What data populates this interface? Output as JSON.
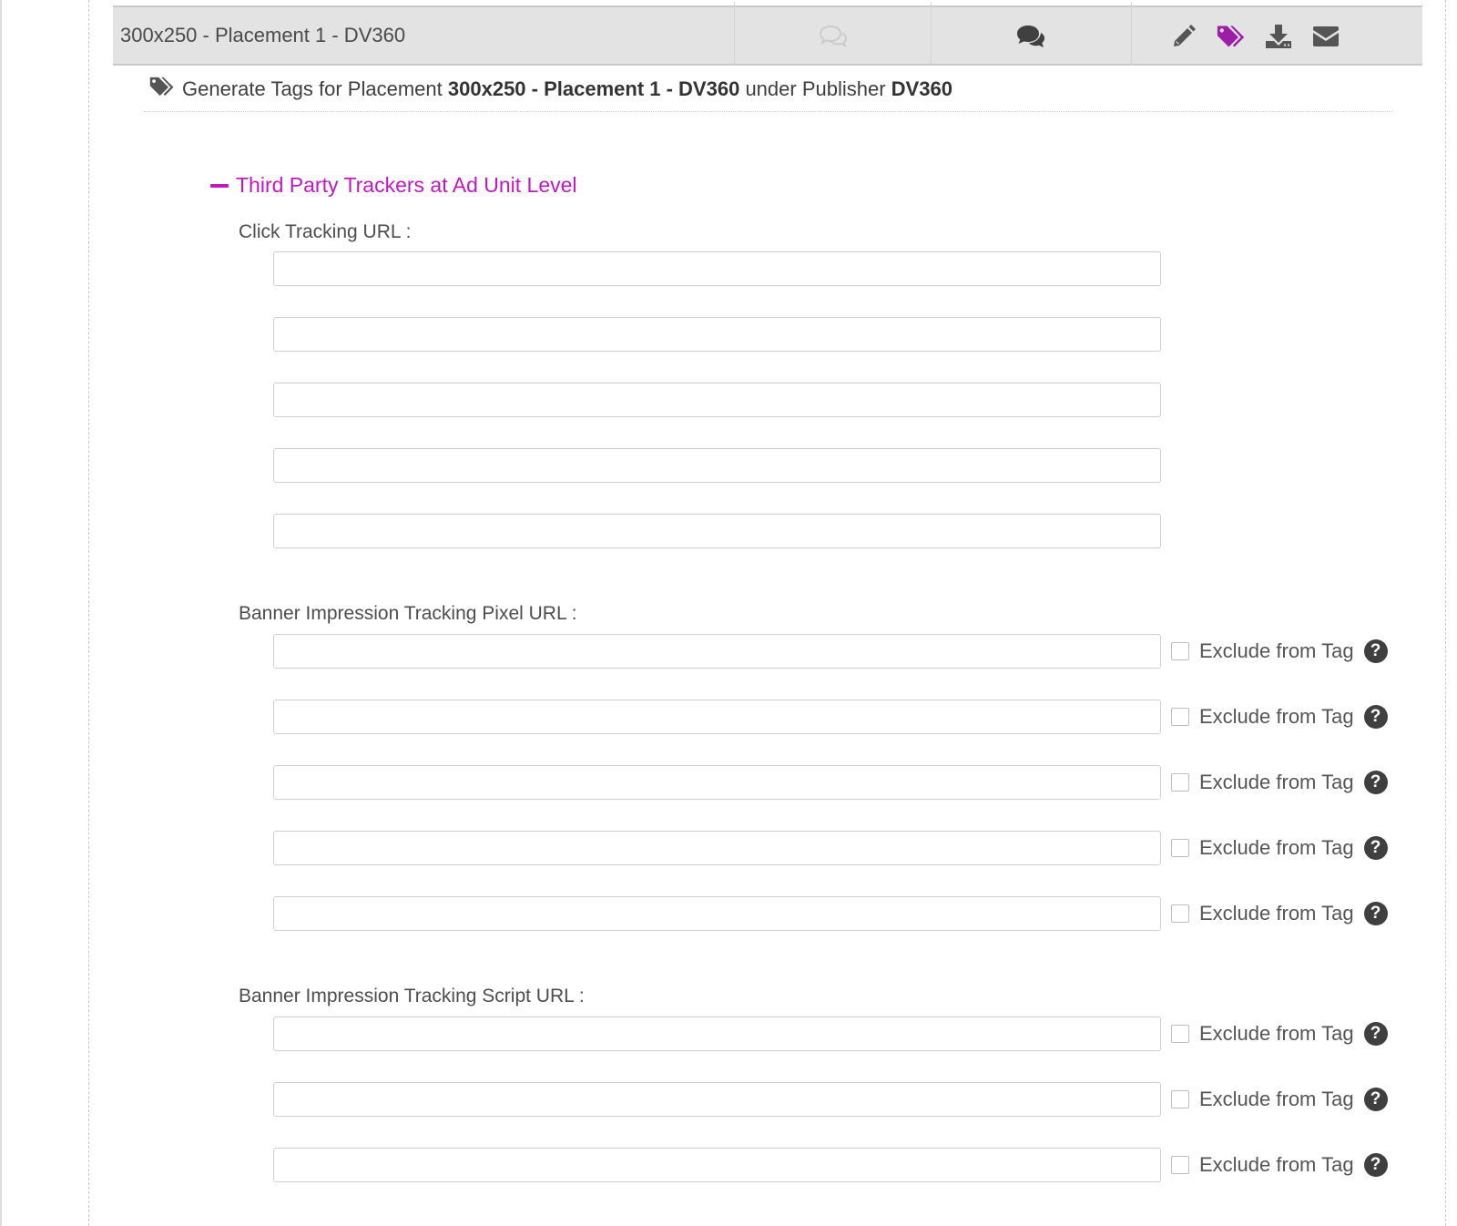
{
  "placement": {
    "name": "300x250 - Placement 1 - DV360",
    "icons": {
      "comments_outline": "comments-outline-icon",
      "comments": "comments-icon",
      "edit": "pencil-icon",
      "tags": "tags-icon",
      "download": "download-icon",
      "email": "envelope-icon"
    },
    "active_color": "#9b1fa6",
    "icon_color": "#555555"
  },
  "generate": {
    "prefix": "Generate Tags for Placement",
    "placement_name": "300x250 - Placement 1 - DV360",
    "middle": "under Publisher",
    "publisher": "DV360"
  },
  "section": {
    "title": "Third Party Trackers at Ad Unit Level",
    "accent_color": "#c018c4"
  },
  "click_tracking": {
    "label": "Click Tracking URL :",
    "values": [
      "",
      "",
      "",
      "",
      ""
    ]
  },
  "pixel_tracking": {
    "label": "Banner Impression Tracking Pixel URL :",
    "values": [
      "",
      "",
      "",
      "",
      ""
    ],
    "exclude_label": "Exclude from Tag",
    "exclude_checked": [
      false,
      false,
      false,
      false,
      false
    ]
  },
  "script_tracking": {
    "label": "Banner Impression Tracking Script URL :",
    "values": [
      "",
      "",
      ""
    ],
    "exclude_label": "Exclude from Tag",
    "exclude_checked": [
      false,
      false,
      false
    ]
  },
  "help_glyph": "?"
}
